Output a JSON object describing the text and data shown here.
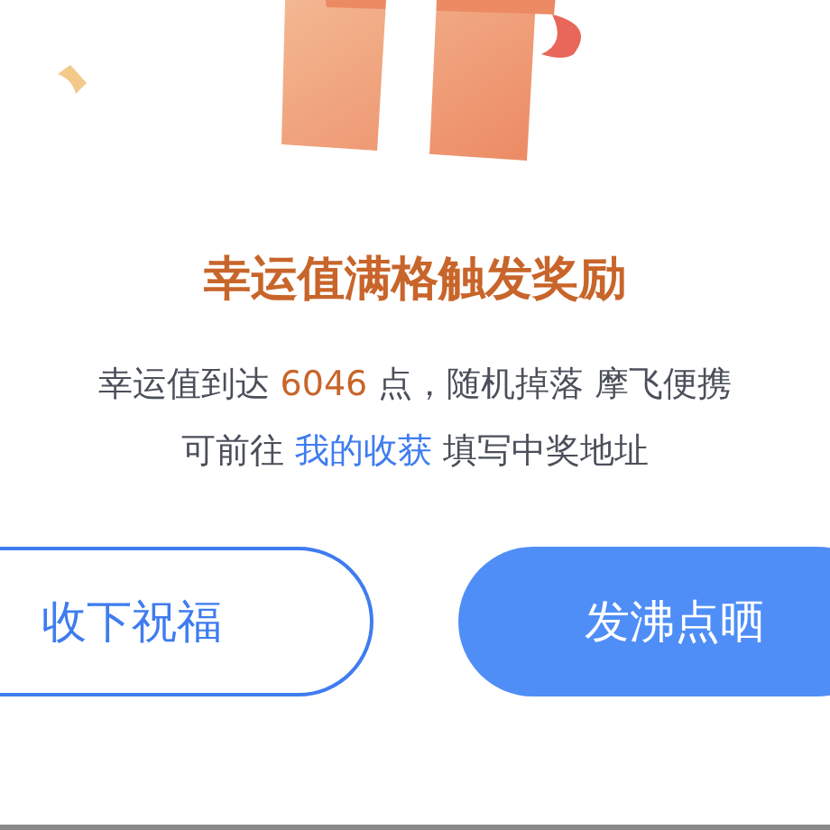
{
  "title": "幸运值满格触发奖励",
  "message": [
    {
      "kind": "text",
      "text": "幸运值到达 "
    },
    {
      "kind": "highlight",
      "text": "6046"
    },
    {
      "kind": "text",
      "text": " 点，随机掉落 摩飞便携"
    }
  ],
  "hint": [
    {
      "kind": "text",
      "text": "可前往 "
    },
    {
      "kind": "link",
      "text": "我的收获"
    },
    {
      "kind": "text",
      "text": " 填写中奖地址"
    }
  ],
  "buttons": [
    {
      "label": "收下祝福",
      "kind": "outline"
    },
    {
      "label": "发沸点晒",
      "kind": "primary"
    }
  ]
}
